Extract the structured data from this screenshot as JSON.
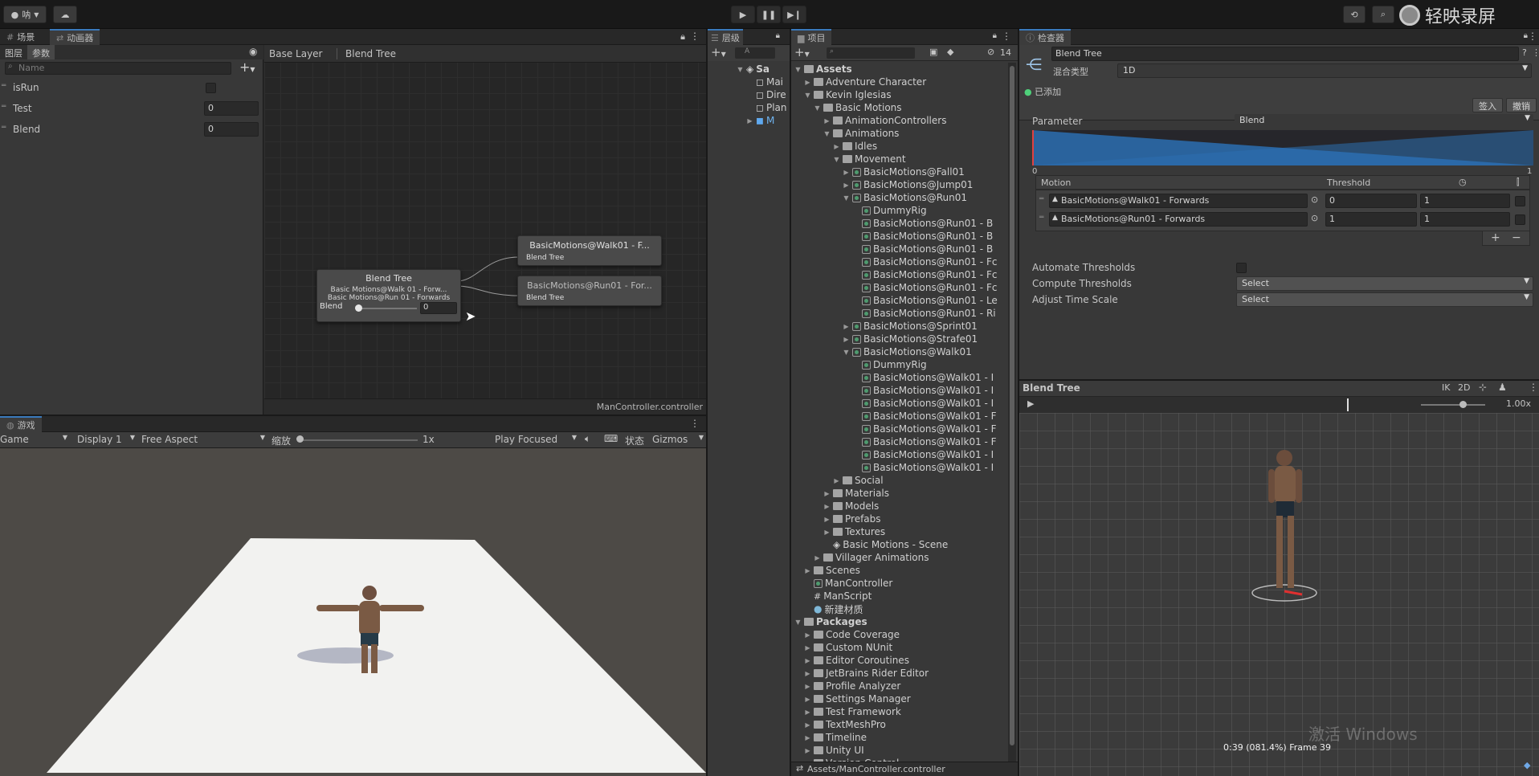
{
  "toolbar": {
    "account_label": "呐",
    "watermark": "轻映录屏"
  },
  "animator_panel": {
    "tabs": [
      "场景",
      "动画器"
    ],
    "sub_tabs": [
      "图层",
      "参数"
    ],
    "search_placeholder": "Name",
    "breadcrumb": [
      "Base Layer",
      "Blend Tree"
    ],
    "parameters": [
      {
        "name": "isRun",
        "value": ""
      },
      {
        "name": "Test",
        "value": "0"
      },
      {
        "name": "Blend",
        "value": "0"
      }
    ],
    "graph": {
      "blend_tree_node": {
        "title": "Blend Tree",
        "lines": [
          "Basic Motions@Walk 01 - Forw...",
          "Basic Motions@Run 01 - Forwards"
        ],
        "param_label": "Blend",
        "param_value": "0"
      },
      "child_nodes": [
        {
          "title": "BasicMotions@Walk01 - F...",
          "sub": "Blend Tree"
        },
        {
          "title": "BasicMotions@Run01 - For...",
          "sub": "Blend Tree"
        }
      ],
      "footer": "ManController.controller"
    }
  },
  "game_panel": {
    "tab": "游戏",
    "game_label": "Game",
    "display": "Display 1",
    "aspect": "Free Aspect",
    "scale_label": "缩放",
    "scale_value": "1x",
    "play_mode": "Play Focused",
    "stats": "状态",
    "gizmos": "Gizmos"
  },
  "hierarchy": {
    "tab": "层级",
    "search_hint": "A",
    "items": [
      "Sa",
      "Mai",
      "Dire",
      "Plan",
      "M"
    ]
  },
  "project": {
    "tab": "项目",
    "count": "14",
    "tree": [
      {
        "label": "Assets",
        "depth": 0,
        "fold": "open",
        "kind": "folder",
        "bold": true
      },
      {
        "label": "Adventure Character",
        "depth": 1,
        "fold": "closed",
        "kind": "folder"
      },
      {
        "label": "Kevin Iglesias",
        "depth": 1,
        "fold": "open",
        "kind": "folder"
      },
      {
        "label": "Basic Motions",
        "depth": 2,
        "fold": "open",
        "kind": "folder"
      },
      {
        "label": "AnimationControllers",
        "depth": 3,
        "fold": "closed",
        "kind": "folder"
      },
      {
        "label": "Animations",
        "depth": 3,
        "fold": "open",
        "kind": "folder"
      },
      {
        "label": "Idles",
        "depth": 4,
        "fold": "closed",
        "kind": "folder"
      },
      {
        "label": "Movement",
        "depth": 4,
        "fold": "open",
        "kind": "folder"
      },
      {
        "label": "BasicMotions@Fall01",
        "depth": 5,
        "fold": "closed",
        "kind": "anim"
      },
      {
        "label": "BasicMotions@Jump01",
        "depth": 5,
        "fold": "closed",
        "kind": "anim"
      },
      {
        "label": "BasicMotions@Run01",
        "depth": 5,
        "fold": "open",
        "kind": "anim"
      },
      {
        "label": "DummyRig",
        "depth": 6,
        "fold": "",
        "kind": "anim"
      },
      {
        "label": "BasicMotions@Run01 - B",
        "depth": 6,
        "fold": "",
        "kind": "anim"
      },
      {
        "label": "BasicMotions@Run01 - B",
        "depth": 6,
        "fold": "",
        "kind": "anim"
      },
      {
        "label": "BasicMotions@Run01 - B",
        "depth": 6,
        "fold": "",
        "kind": "anim"
      },
      {
        "label": "BasicMotions@Run01 - Fc",
        "depth": 6,
        "fold": "",
        "kind": "anim"
      },
      {
        "label": "BasicMotions@Run01 - Fc",
        "depth": 6,
        "fold": "",
        "kind": "anim"
      },
      {
        "label": "BasicMotions@Run01 - Fc",
        "depth": 6,
        "fold": "",
        "kind": "anim"
      },
      {
        "label": "BasicMotions@Run01 - Le",
        "depth": 6,
        "fold": "",
        "kind": "anim"
      },
      {
        "label": "BasicMotions@Run01 - Ri",
        "depth": 6,
        "fold": "",
        "kind": "anim"
      },
      {
        "label": "BasicMotions@Sprint01",
        "depth": 5,
        "fold": "closed",
        "kind": "anim"
      },
      {
        "label": "BasicMotions@Strafe01",
        "depth": 5,
        "fold": "closed",
        "kind": "anim"
      },
      {
        "label": "BasicMotions@Walk01",
        "depth": 5,
        "fold": "open",
        "kind": "anim"
      },
      {
        "label": "DummyRig",
        "depth": 6,
        "fold": "",
        "kind": "anim"
      },
      {
        "label": "BasicMotions@Walk01 - I",
        "depth": 6,
        "fold": "",
        "kind": "anim"
      },
      {
        "label": "BasicMotions@Walk01 - I",
        "depth": 6,
        "fold": "",
        "kind": "anim"
      },
      {
        "label": "BasicMotions@Walk01 - I",
        "depth": 6,
        "fold": "",
        "kind": "anim"
      },
      {
        "label": "BasicMotions@Walk01 - F",
        "depth": 6,
        "fold": "",
        "kind": "anim"
      },
      {
        "label": "BasicMotions@Walk01 - F",
        "depth": 6,
        "fold": "",
        "kind": "anim"
      },
      {
        "label": "BasicMotions@Walk01 - F",
        "depth": 6,
        "fold": "",
        "kind": "anim"
      },
      {
        "label": "BasicMotions@Walk01 - I",
        "depth": 6,
        "fold": "",
        "kind": "anim"
      },
      {
        "label": "BasicMotions@Walk01 - I",
        "depth": 6,
        "fold": "",
        "kind": "anim"
      },
      {
        "label": "Social",
        "depth": 4,
        "fold": "closed",
        "kind": "folder"
      },
      {
        "label": "Materials",
        "depth": 3,
        "fold": "closed",
        "kind": "folder"
      },
      {
        "label": "Models",
        "depth": 3,
        "fold": "closed",
        "kind": "folder"
      },
      {
        "label": "Prefabs",
        "depth": 3,
        "fold": "closed",
        "kind": "folder"
      },
      {
        "label": "Textures",
        "depth": 3,
        "fold": "closed",
        "kind": "folder"
      },
      {
        "label": "Basic Motions - Scene",
        "depth": 3,
        "fold": "",
        "kind": "scene"
      },
      {
        "label": "Villager Animations",
        "depth": 2,
        "fold": "closed",
        "kind": "folder"
      },
      {
        "label": "Scenes",
        "depth": 1,
        "fold": "closed",
        "kind": "folder"
      },
      {
        "label": "ManController",
        "depth": 1,
        "fold": "",
        "kind": "anim"
      },
      {
        "label": "ManScript",
        "depth": 1,
        "fold": "",
        "kind": "script"
      },
      {
        "label": "新建材质",
        "depth": 1,
        "fold": "",
        "kind": "material"
      },
      {
        "label": "Packages",
        "depth": 0,
        "fold": "open",
        "kind": "folder",
        "bold": true
      },
      {
        "label": "Code Coverage",
        "depth": 1,
        "fold": "closed",
        "kind": "folder"
      },
      {
        "label": "Custom NUnit",
        "depth": 1,
        "fold": "closed",
        "kind": "folder"
      },
      {
        "label": "Editor Coroutines",
        "depth": 1,
        "fold": "closed",
        "kind": "folder"
      },
      {
        "label": "JetBrains Rider Editor",
        "depth": 1,
        "fold": "closed",
        "kind": "folder"
      },
      {
        "label": "Profile Analyzer",
        "depth": 1,
        "fold": "closed",
        "kind": "folder"
      },
      {
        "label": "Settings Manager",
        "depth": 1,
        "fold": "closed",
        "kind": "folder"
      },
      {
        "label": "Test Framework",
        "depth": 1,
        "fold": "closed",
        "kind": "folder"
      },
      {
        "label": "TextMeshPro",
        "depth": 1,
        "fold": "closed",
        "kind": "folder"
      },
      {
        "label": "Timeline",
        "depth": 1,
        "fold": "closed",
        "kind": "folder"
      },
      {
        "label": "Unity UI",
        "depth": 1,
        "fold": "closed",
        "kind": "folder"
      },
      {
        "label": "Version Control",
        "depth": 1,
        "fold": "closed",
        "kind": "folder"
      }
    ],
    "footer_path": "Assets/ManController.controller"
  },
  "inspector": {
    "tab": "检查器",
    "object_name": "Blend Tree",
    "blend_type_label": "混合类型",
    "blend_type_value": "1D",
    "added_label": "已添加",
    "sign_in": "签入",
    "revert": "撤销",
    "parameter_label": "Parameter",
    "parameter_value": "Blend",
    "range_min": "0",
    "range_max": "1",
    "motion_header": "Motion",
    "threshold_header": "Threshold",
    "motions": [
      {
        "name": "BasicMotions@Walk01 - Forwards",
        "threshold": "0",
        "speed": "1"
      },
      {
        "name": "BasicMotions@Run01 - Forwards",
        "threshold": "1",
        "speed": "1"
      }
    ],
    "automate_label": "Automate Thresholds",
    "compute_label": "Compute Thresholds",
    "compute_value": "Select",
    "adjust_label": "Adjust Time Scale",
    "adjust_value": "Select"
  },
  "preview": {
    "title": "Blend Tree",
    "ik": "IK",
    "two_d": "2D",
    "speed": "1.00x",
    "status": "0:39 (081.4%) Frame 39",
    "watermark": "激活 Windows"
  }
}
